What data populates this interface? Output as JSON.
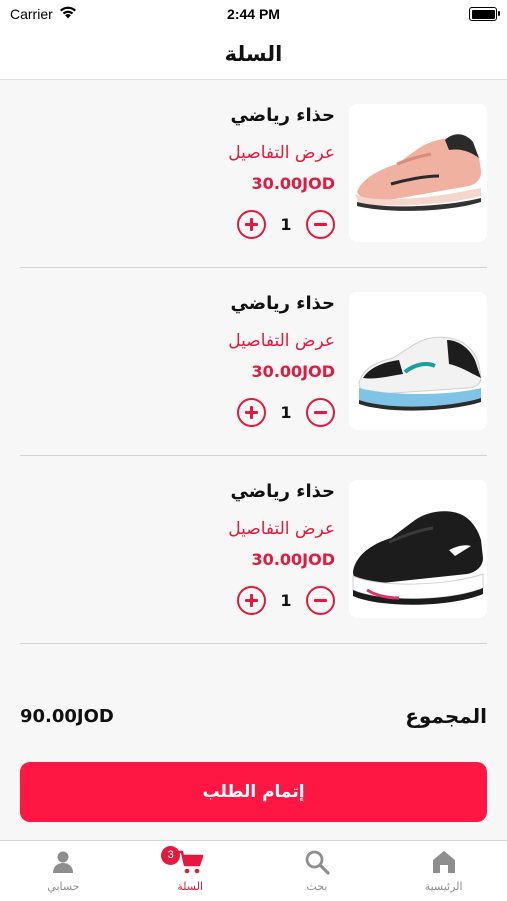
{
  "status_bar": {
    "carrier": "Carrier",
    "time": "2:44 PM",
    "battery_level": 1.0
  },
  "header": {
    "title": "السلة"
  },
  "cart": {
    "items": [
      {
        "name": "حذاء رياضي",
        "details_link": "عرض التفاصيل",
        "price": "30.00JOD",
        "quantity": "1",
        "image": "pink-sneaker-image"
      },
      {
        "name": "حذاء رياضي",
        "details_link": "عرض التفاصيل",
        "price": "30.00JOD",
        "quantity": "1",
        "image": "white-teal-sneaker-image"
      },
      {
        "name": "حذاء رياضي",
        "details_link": "عرض التفاصيل",
        "price": "30.00JOD",
        "quantity": "1",
        "image": "black-sneaker-image"
      }
    ]
  },
  "summary": {
    "total_label": "المجموع",
    "total_value": "90.00JOD"
  },
  "checkout": {
    "label": "إتمام الطلب"
  },
  "tab_bar": {
    "items": [
      {
        "label": "الرئيسية",
        "icon": "home-icon",
        "active": false
      },
      {
        "label": "بحث",
        "icon": "search-icon",
        "active": false
      },
      {
        "label": "السلة",
        "icon": "cart-icon",
        "active": true,
        "badge": "3"
      },
      {
        "label": "حسابي",
        "icon": "person-icon",
        "active": false
      }
    ]
  },
  "colors": {
    "accent": "#e5193f",
    "button": "#ff1744",
    "background": "#f7f7f7"
  }
}
